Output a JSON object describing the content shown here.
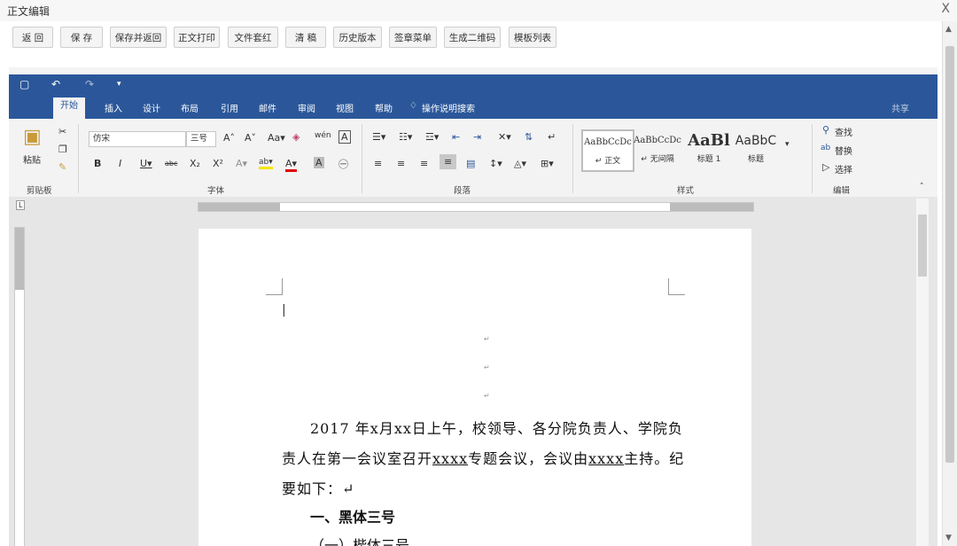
{
  "window": {
    "title": "正文编辑",
    "close_glyph": "X"
  },
  "toolbar": {
    "buttons": [
      "返 回",
      "保 存",
      "保存并返回",
      "正文打印",
      "文件套红",
      "清 稿",
      "历史版本",
      "签章菜单",
      "生成二维码",
      "模板列表"
    ]
  },
  "word": {
    "qat_icons": [
      "save-icon",
      "undo-icon",
      "redo-icon",
      "customize-icon"
    ],
    "tabs": [
      "开始",
      "插入",
      "设计",
      "布局",
      "引用",
      "邮件",
      "审阅",
      "视图",
      "帮助",
      "操作说明搜索"
    ],
    "share": "共享",
    "ribbon": {
      "clipboard": {
        "paste": "粘贴",
        "label": "剪贴板"
      },
      "font": {
        "name": "仿宋",
        "size": "三号",
        "label": "字体"
      },
      "paragraph": {
        "label": "段落"
      },
      "styles": {
        "label": "样式",
        "items": [
          {
            "preview": "AaBbCcDc",
            "name": "↵ 正文"
          },
          {
            "preview": "AaBbCcDc",
            "name": "↵ 无间隔"
          },
          {
            "preview": "AaBl",
            "name": "标题 1"
          },
          {
            "preview": "AaBbC",
            "name": "标题"
          }
        ]
      },
      "editing": {
        "find": "查找",
        "replace": "替换",
        "select": "选择",
        "label": "编辑"
      }
    },
    "document": {
      "para_line1_a": "2017 年x月xx日上午，校领导、各分院负责人、学院负",
      "para_line2_a": "责人在第一会议室召开",
      "para_line2_u1": "xxxx",
      "para_line2_b": "专题会议，会议由",
      "para_line2_u2": "xxxx",
      "para_line2_c": "主持。纪",
      "para_line3": "要如下：↵",
      "heading1": "一、黑体三号",
      "heading2": "（一）楷体三号"
    },
    "colors": {
      "accent": "#2b579a"
    }
  }
}
